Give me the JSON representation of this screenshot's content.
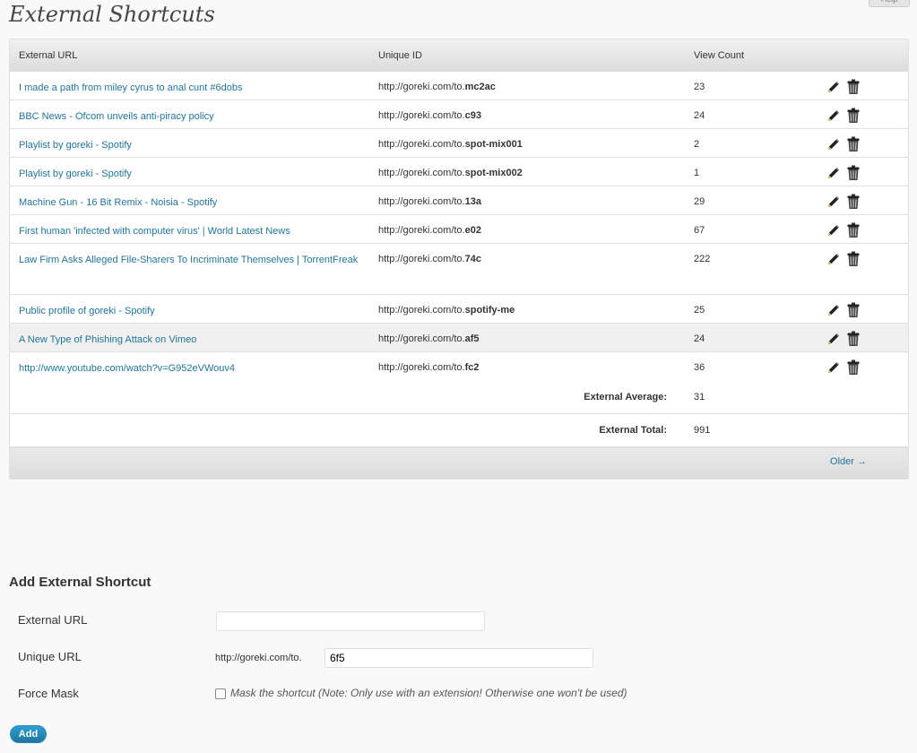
{
  "help_tab": "Help",
  "page_title": "External Shortcuts",
  "table": {
    "columns": [
      "External URL",
      "Unique ID",
      "View Count"
    ],
    "uid_prefix": "http://goreki.com/to.",
    "rows": [
      {
        "url": "I made a path from miley cyrus to anal cunt #6dobs",
        "slug": "mc2ac",
        "count": "23"
      },
      {
        "url": "BBC News - Ofcom unveils anti-piracy policy",
        "slug": "c93",
        "count": "24"
      },
      {
        "url": "Playlist by goreki - Spotify",
        "slug": "spot-mix001",
        "count": "2"
      },
      {
        "url": "Playlist by goreki - Spotify",
        "slug": "spot-mix002",
        "count": "1"
      },
      {
        "url": "Machine Gun - 16 Bit Remix - Noisia - Spotify",
        "slug": "13a",
        "count": "29"
      },
      {
        "url": "First human 'infected with computer virus' | World Latest News",
        "slug": "e02",
        "count": "67"
      },
      {
        "url": "Law Firm Asks Alleged File-Sharers To Incriminate Themselves | TorrentFreak",
        "slug": "74c",
        "count": "222"
      },
      {
        "url": "Public profile of goreki - Spotify",
        "slug": "spotify-me",
        "count": "25"
      },
      {
        "url": "A New Type of Phishing Attack on Vimeo",
        "slug": "af5",
        "count": "24"
      },
      {
        "url": "http://www.youtube.com/watch?v=G952eVWouv4",
        "slug": "fc2",
        "count": "36"
      }
    ],
    "average_label": "External Average:",
    "average_value": "31",
    "total_label": "External Total:",
    "total_value": "991",
    "older_link": "Older →"
  },
  "form": {
    "title": "Add External Shortcut",
    "external_url_label": "External URL",
    "external_url_value": "",
    "unique_url_label": "Unique URL",
    "unique_url_prefix": "http://goreki.com/to.",
    "unique_url_value": "6f5",
    "force_mask_label": "Force Mask",
    "force_mask_checked": false,
    "force_mask_note": "Mask the shortcut (Note: Only use with an extension! Otherwise one won't be used)",
    "add_button": "Add"
  },
  "colors": {
    "link": "#21759b",
    "button": "#21759b"
  }
}
